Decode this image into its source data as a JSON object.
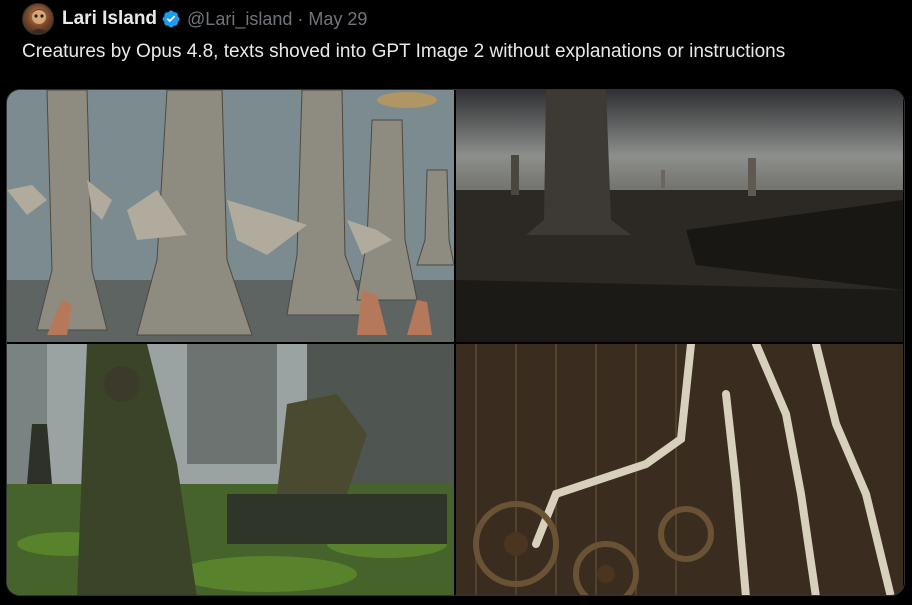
{
  "post": {
    "author": {
      "display_name": "Lari Island",
      "handle": "@Lari_island",
      "separator": "·",
      "date": "May 29",
      "verified": true
    },
    "text": "Creatures by Opus 4.8, texts shoved into GPT Image 2 without explanations or instructions",
    "media": [
      {
        "icon": "tree-creatures-image"
      },
      {
        "icon": "dark-tower-cliff-image"
      },
      {
        "icon": "mossy-wanderers-image"
      },
      {
        "icon": "skeletal-machine-image"
      }
    ]
  },
  "colors": {
    "background": "#000000",
    "text_primary": "#e7e9ea",
    "text_secondary": "#71767b",
    "verified_badge": "#1d9bf0"
  }
}
